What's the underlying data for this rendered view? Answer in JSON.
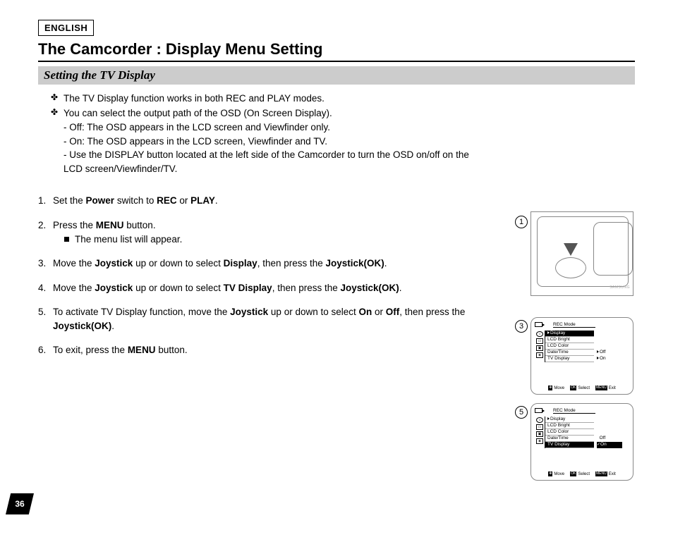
{
  "lang": "ENGLISH",
  "title": "The Camcorder : Display Menu Setting",
  "subtitle": "Setting the TV Display",
  "bullets": {
    "b1": "The TV Display function works in both REC and PLAY modes.",
    "b2": "You can select the output path of the OSD (On Screen Display).",
    "b2a": "- Off: The OSD appears in the LCD screen and Viewfinder only.",
    "b2b": "- On: The OSD appears in the LCD screen, Viewfinder and TV.",
    "b2c": "- Use the DISPLAY button located at the left side of the Camcorder to turn the OSD on/off on the LCD screen/Viewfinder/TV."
  },
  "steps": {
    "s1a": "Set the ",
    "s1b": "Power",
    "s1c": " switch to ",
    "s1d": "REC",
    "s1e": " or ",
    "s1f": "PLAY",
    "s1g": ".",
    "s2a": "Press the ",
    "s2b": "MENU",
    "s2c": " button.",
    "s2sub": "The menu list will appear.",
    "s3a": "Move the ",
    "s3b": "Joystick",
    "s3c": " up or down to select ",
    "s3d": "Display",
    "s3e": ", then press the ",
    "s3f": "Joystick(OK)",
    "s3g": ".",
    "s4a": "Move the ",
    "s4b": "Joystick",
    "s4c": " up or down to select ",
    "s4d": "TV Display",
    "s4e": ", then press the ",
    "s4f": "Joystick(OK)",
    "s4g": ".",
    "s5a": "To activate TV Display function, move the ",
    "s5b": "Joystick",
    "s5c": " up or down to select ",
    "s5d": "On",
    "s5e": " or ",
    "s5f": "Off",
    "s5g": ", then press the ",
    "s5h": "Joystick(OK)",
    "s5i": ".",
    "s6a": "To exit, press the ",
    "s6b": "MENU",
    "s6c": " button."
  },
  "fig": {
    "n1": "1",
    "n3": "3",
    "n5": "5",
    "brand": "SAMSUNG"
  },
  "osd": {
    "mode": "REC Mode",
    "menu": {
      "display": "Display",
      "lcd_bright": "LCD Bright",
      "lcd_color": "LCD Color",
      "date_time": "Date/Time",
      "tv_display": "TV Display"
    },
    "opt": {
      "off": "Off",
      "on": "On"
    },
    "foot": {
      "move": "Move",
      "select": "Select",
      "exit": "Exit",
      "ok": "OK",
      "menu": "MENU"
    }
  },
  "page_number": "36"
}
